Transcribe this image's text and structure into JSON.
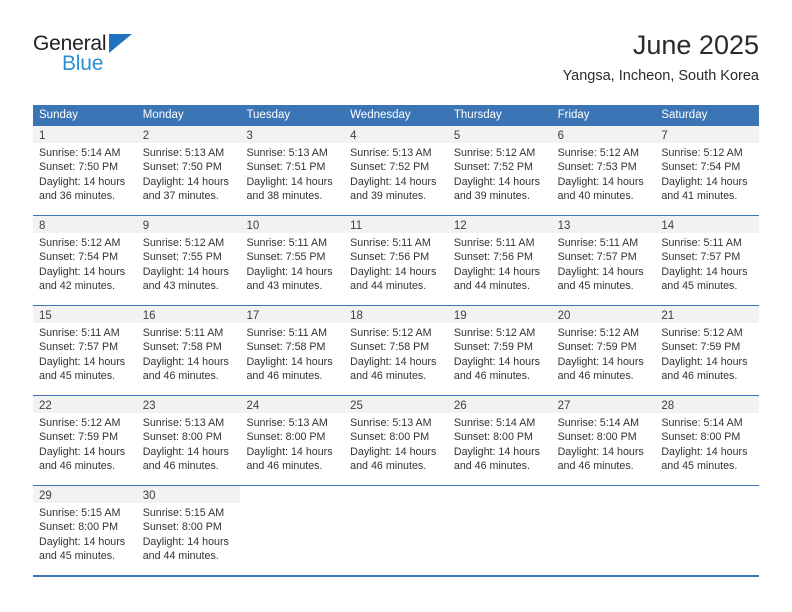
{
  "logo": {
    "word_top": "General",
    "word_bottom": "Blue",
    "triangle_icon": "triangle-icon",
    "color_dark": "#231f20",
    "color_blue": "#2a8fd4"
  },
  "header": {
    "title": "June 2025",
    "subtitle": "Yangsa, Incheon, South Korea"
  },
  "theme": {
    "header_blue": "#3b75b5",
    "daynum_band": "#f2f2f2",
    "text": "#333333"
  },
  "calendar": {
    "weekday_headers": [
      "Sunday",
      "Monday",
      "Tuesday",
      "Wednesday",
      "Thursday",
      "Friday",
      "Saturday"
    ],
    "weeks": [
      [
        {
          "day": "1",
          "sunrise": "Sunrise: 5:14 AM",
          "sunset": "Sunset: 7:50 PM",
          "daylight1": "Daylight: 14 hours",
          "daylight2": "and 36 minutes."
        },
        {
          "day": "2",
          "sunrise": "Sunrise: 5:13 AM",
          "sunset": "Sunset: 7:50 PM",
          "daylight1": "Daylight: 14 hours",
          "daylight2": "and 37 minutes."
        },
        {
          "day": "3",
          "sunrise": "Sunrise: 5:13 AM",
          "sunset": "Sunset: 7:51 PM",
          "daylight1": "Daylight: 14 hours",
          "daylight2": "and 38 minutes."
        },
        {
          "day": "4",
          "sunrise": "Sunrise: 5:13 AM",
          "sunset": "Sunset: 7:52 PM",
          "daylight1": "Daylight: 14 hours",
          "daylight2": "and 39 minutes."
        },
        {
          "day": "5",
          "sunrise": "Sunrise: 5:12 AM",
          "sunset": "Sunset: 7:52 PM",
          "daylight1": "Daylight: 14 hours",
          "daylight2": "and 39 minutes."
        },
        {
          "day": "6",
          "sunrise": "Sunrise: 5:12 AM",
          "sunset": "Sunset: 7:53 PM",
          "daylight1": "Daylight: 14 hours",
          "daylight2": "and 40 minutes."
        },
        {
          "day": "7",
          "sunrise": "Sunrise: 5:12 AM",
          "sunset": "Sunset: 7:54 PM",
          "daylight1": "Daylight: 14 hours",
          "daylight2": "and 41 minutes."
        }
      ],
      [
        {
          "day": "8",
          "sunrise": "Sunrise: 5:12 AM",
          "sunset": "Sunset: 7:54 PM",
          "daylight1": "Daylight: 14 hours",
          "daylight2": "and 42 minutes."
        },
        {
          "day": "9",
          "sunrise": "Sunrise: 5:12 AM",
          "sunset": "Sunset: 7:55 PM",
          "daylight1": "Daylight: 14 hours",
          "daylight2": "and 43 minutes."
        },
        {
          "day": "10",
          "sunrise": "Sunrise: 5:11 AM",
          "sunset": "Sunset: 7:55 PM",
          "daylight1": "Daylight: 14 hours",
          "daylight2": "and 43 minutes."
        },
        {
          "day": "11",
          "sunrise": "Sunrise: 5:11 AM",
          "sunset": "Sunset: 7:56 PM",
          "daylight1": "Daylight: 14 hours",
          "daylight2": "and 44 minutes."
        },
        {
          "day": "12",
          "sunrise": "Sunrise: 5:11 AM",
          "sunset": "Sunset: 7:56 PM",
          "daylight1": "Daylight: 14 hours",
          "daylight2": "and 44 minutes."
        },
        {
          "day": "13",
          "sunrise": "Sunrise: 5:11 AM",
          "sunset": "Sunset: 7:57 PM",
          "daylight1": "Daylight: 14 hours",
          "daylight2": "and 45 minutes."
        },
        {
          "day": "14",
          "sunrise": "Sunrise: 5:11 AM",
          "sunset": "Sunset: 7:57 PM",
          "daylight1": "Daylight: 14 hours",
          "daylight2": "and 45 minutes."
        }
      ],
      [
        {
          "day": "15",
          "sunrise": "Sunrise: 5:11 AM",
          "sunset": "Sunset: 7:57 PM",
          "daylight1": "Daylight: 14 hours",
          "daylight2": "and 45 minutes."
        },
        {
          "day": "16",
          "sunrise": "Sunrise: 5:11 AM",
          "sunset": "Sunset: 7:58 PM",
          "daylight1": "Daylight: 14 hours",
          "daylight2": "and 46 minutes."
        },
        {
          "day": "17",
          "sunrise": "Sunrise: 5:11 AM",
          "sunset": "Sunset: 7:58 PM",
          "daylight1": "Daylight: 14 hours",
          "daylight2": "and 46 minutes."
        },
        {
          "day": "18",
          "sunrise": "Sunrise: 5:12 AM",
          "sunset": "Sunset: 7:58 PM",
          "daylight1": "Daylight: 14 hours",
          "daylight2": "and 46 minutes."
        },
        {
          "day": "19",
          "sunrise": "Sunrise: 5:12 AM",
          "sunset": "Sunset: 7:59 PM",
          "daylight1": "Daylight: 14 hours",
          "daylight2": "and 46 minutes."
        },
        {
          "day": "20",
          "sunrise": "Sunrise: 5:12 AM",
          "sunset": "Sunset: 7:59 PM",
          "daylight1": "Daylight: 14 hours",
          "daylight2": "and 46 minutes."
        },
        {
          "day": "21",
          "sunrise": "Sunrise: 5:12 AM",
          "sunset": "Sunset: 7:59 PM",
          "daylight1": "Daylight: 14 hours",
          "daylight2": "and 46 minutes."
        }
      ],
      [
        {
          "day": "22",
          "sunrise": "Sunrise: 5:12 AM",
          "sunset": "Sunset: 7:59 PM",
          "daylight1": "Daylight: 14 hours",
          "daylight2": "and 46 minutes."
        },
        {
          "day": "23",
          "sunrise": "Sunrise: 5:13 AM",
          "sunset": "Sunset: 8:00 PM",
          "daylight1": "Daylight: 14 hours",
          "daylight2": "and 46 minutes."
        },
        {
          "day": "24",
          "sunrise": "Sunrise: 5:13 AM",
          "sunset": "Sunset: 8:00 PM",
          "daylight1": "Daylight: 14 hours",
          "daylight2": "and 46 minutes."
        },
        {
          "day": "25",
          "sunrise": "Sunrise: 5:13 AM",
          "sunset": "Sunset: 8:00 PM",
          "daylight1": "Daylight: 14 hours",
          "daylight2": "and 46 minutes."
        },
        {
          "day": "26",
          "sunrise": "Sunrise: 5:14 AM",
          "sunset": "Sunset: 8:00 PM",
          "daylight1": "Daylight: 14 hours",
          "daylight2": "and 46 minutes."
        },
        {
          "day": "27",
          "sunrise": "Sunrise: 5:14 AM",
          "sunset": "Sunset: 8:00 PM",
          "daylight1": "Daylight: 14 hours",
          "daylight2": "and 46 minutes."
        },
        {
          "day": "28",
          "sunrise": "Sunrise: 5:14 AM",
          "sunset": "Sunset: 8:00 PM",
          "daylight1": "Daylight: 14 hours",
          "daylight2": "and 45 minutes."
        }
      ],
      [
        {
          "day": "29",
          "sunrise": "Sunrise: 5:15 AM",
          "sunset": "Sunset: 8:00 PM",
          "daylight1": "Daylight: 14 hours",
          "daylight2": "and 45 minutes."
        },
        {
          "day": "30",
          "sunrise": "Sunrise: 5:15 AM",
          "sunset": "Sunset: 8:00 PM",
          "daylight1": "Daylight: 14 hours",
          "daylight2": "and 44 minutes."
        },
        {
          "day": "",
          "sunrise": "",
          "sunset": "",
          "daylight1": "",
          "daylight2": ""
        },
        {
          "day": "",
          "sunrise": "",
          "sunset": "",
          "daylight1": "",
          "daylight2": ""
        },
        {
          "day": "",
          "sunrise": "",
          "sunset": "",
          "daylight1": "",
          "daylight2": ""
        },
        {
          "day": "",
          "sunrise": "",
          "sunset": "",
          "daylight1": "",
          "daylight2": ""
        },
        {
          "day": "",
          "sunrise": "",
          "sunset": "",
          "daylight1": "",
          "daylight2": ""
        }
      ]
    ]
  }
}
